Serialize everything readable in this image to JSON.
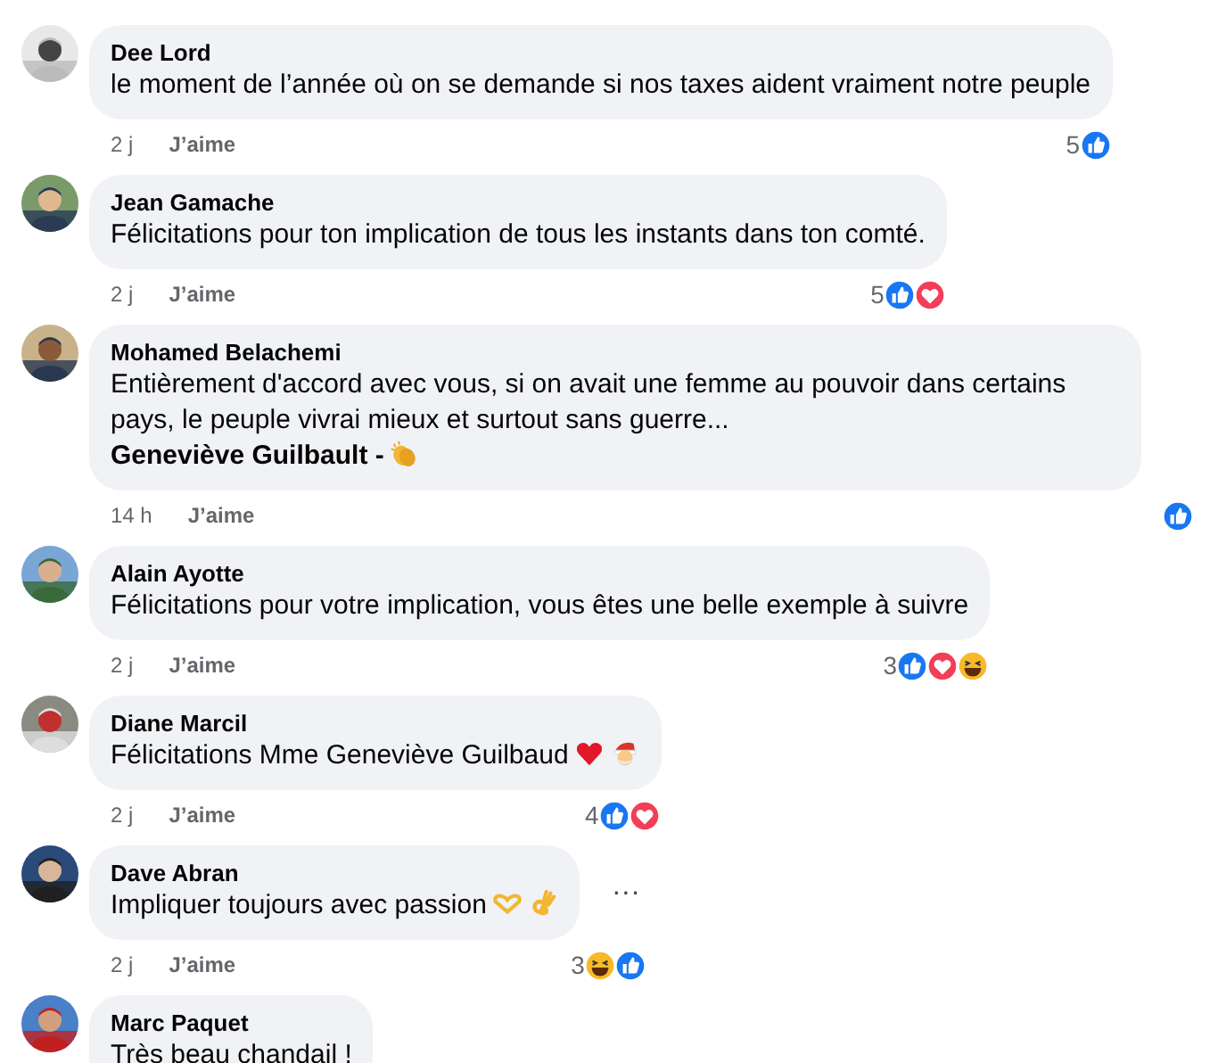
{
  "comments": [
    {
      "author": "Dee Lord",
      "avatar": {
        "kind": "picture"
      },
      "text": "le moment de l’année où on se demande si nos taxes aident vraiment notre peuple",
      "time": "2 j",
      "like_label": "J’aime",
      "reaction_count": "5",
      "reactions": [
        {
          "kind": "like"
        }
      ]
    },
    {
      "author": "Jean Gamache",
      "avatar": {
        "kind": "picture"
      },
      "text": "Félicitations pour ton implication de tous les instants dans ton comté.",
      "time": "2 j",
      "like_label": "J’aime",
      "reaction_count": "5",
      "reactions": [
        {
          "kind": "like"
        },
        {
          "kind": "love"
        }
      ]
    },
    {
      "author": "Mohamed Belachemi",
      "avatar": {
        "kind": "picture"
      },
      "text": "Entièrement d'accord avec vous, si on avait une femme au pouvoir dans certains pays, le peuple vivrai mieux et surtout sans guerre...",
      "mention": "Geneviève Guilbault -",
      "mention_emojis": [
        {
          "kind": "clap"
        }
      ],
      "time": "14 h",
      "like_label": "J’aime",
      "reactions": [
        {
          "kind": "like"
        }
      ]
    },
    {
      "author": "Alain Ayotte",
      "avatar": {
        "kind": "picture"
      },
      "text": "Félicitations pour votre implication, vous êtes une belle exemple à suivre",
      "time": "2 j",
      "like_label": "J’aime",
      "reaction_count": "3",
      "reactions": [
        {
          "kind": "like"
        },
        {
          "kind": "love"
        },
        {
          "kind": "haha"
        }
      ]
    },
    {
      "author": "Diane Marcil",
      "avatar": {
        "kind": "picture"
      },
      "text": "Félicitations Mme Geneviève Guilbaud",
      "emojis": [
        {
          "kind": "heart"
        },
        {
          "kind": "santa"
        }
      ],
      "time": "2 j",
      "like_label": "J’aime",
      "reaction_count": "4",
      "reactions": [
        {
          "kind": "like"
        },
        {
          "kind": "love"
        }
      ]
    },
    {
      "author": "Dave Abran",
      "avatar": {
        "kind": "picture"
      },
      "text": "Impliquer toujours avec passion",
      "emojis": [
        {
          "kind": "heart-hands"
        },
        {
          "kind": "ok-hand"
        }
      ],
      "more_label": "···",
      "time": "2 j",
      "like_label": "J’aime",
      "reaction_count": "3",
      "reactions": [
        {
          "kind": "haha"
        },
        {
          "kind": "like"
        }
      ]
    },
    {
      "author": "Marc Paquet",
      "avatar": {
        "kind": "picture"
      },
      "text": "Très beau chandail !"
    }
  ]
}
